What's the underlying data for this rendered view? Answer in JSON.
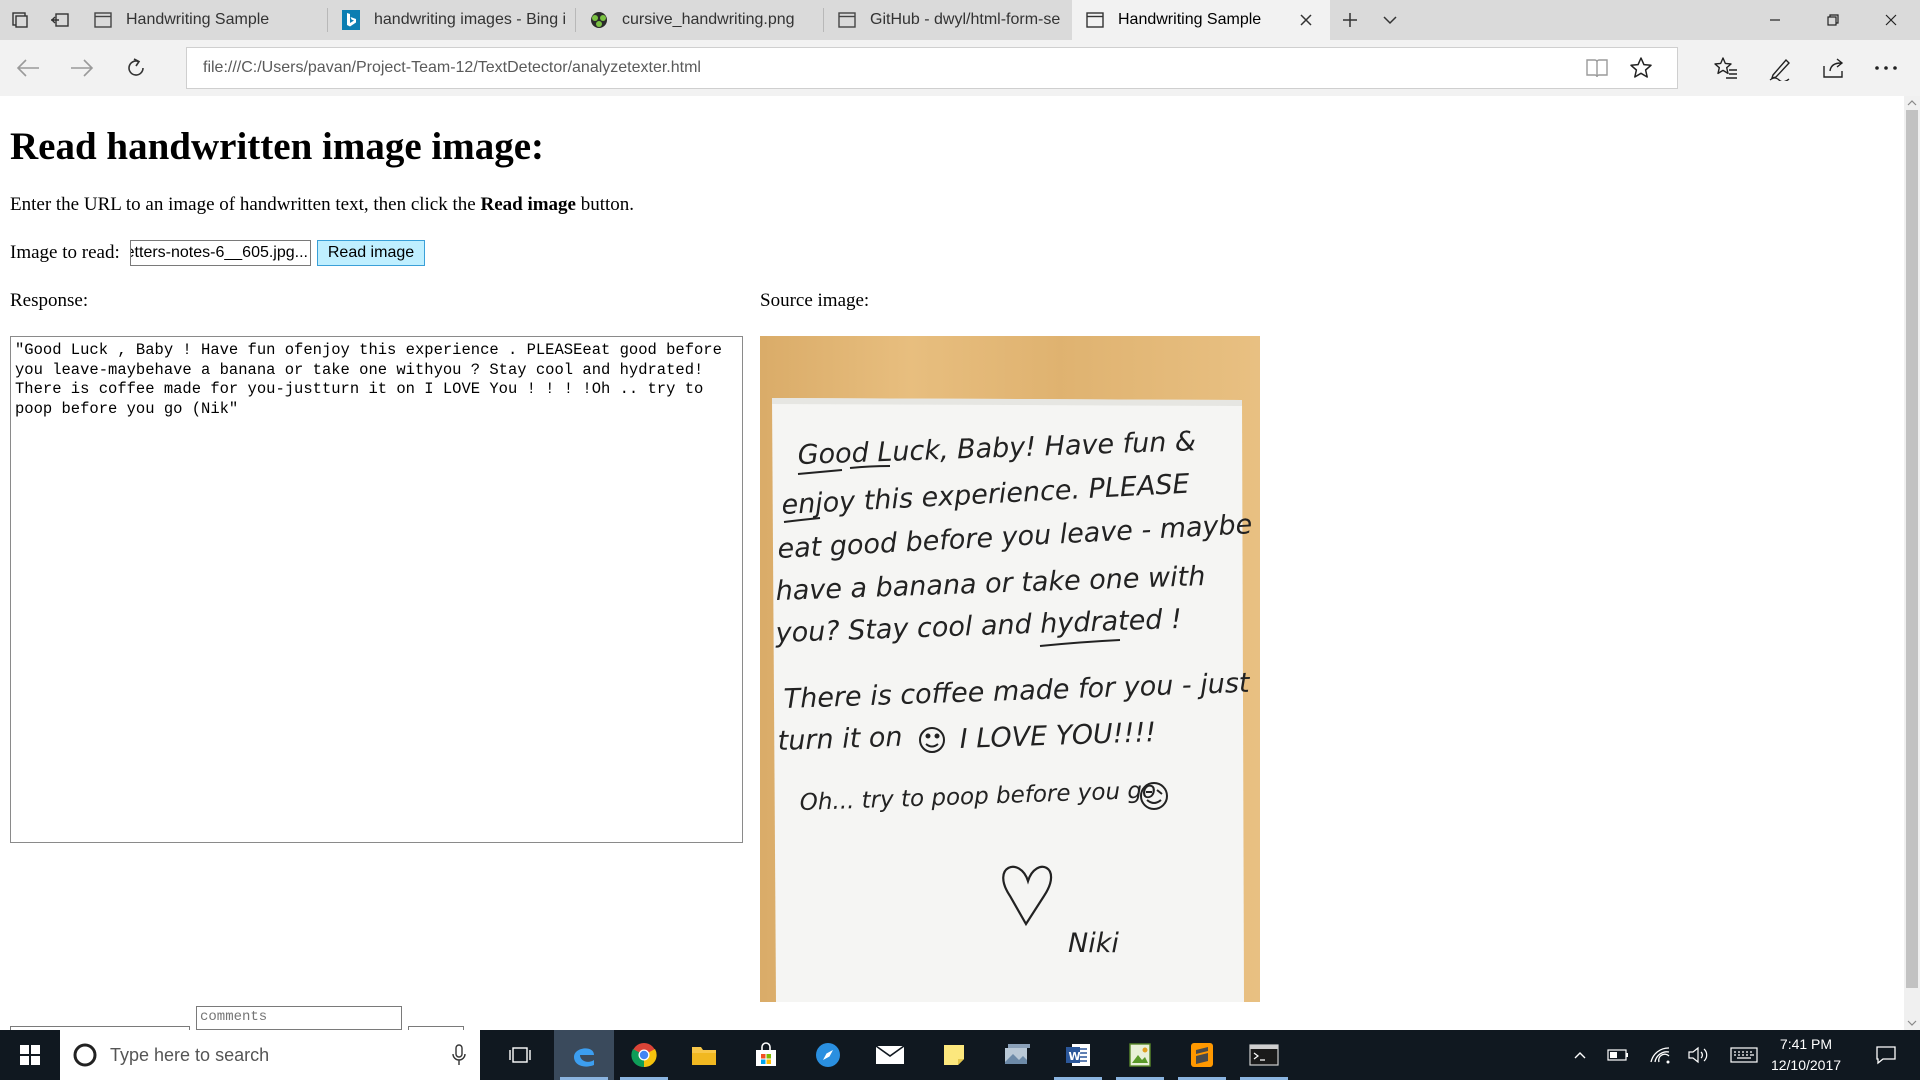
{
  "browser": {
    "tabs": [
      {
        "label": "Handwriting Sample",
        "icon": "page-icon",
        "active": false
      },
      {
        "label": "handwriting images - Bing i",
        "icon": "bing-icon",
        "active": false
      },
      {
        "label": "cursive_handwriting.png",
        "icon": "image-favicon",
        "active": false
      },
      {
        "label": "GitHub - dwyl/html-form-se",
        "icon": "page-icon",
        "active": false
      },
      {
        "label": "Handwriting Sample",
        "icon": "page-icon",
        "active": true
      }
    ],
    "address": "file:///C:/Users/pavan/Project-Team-12/TextDetector/analyzetexter.html"
  },
  "page": {
    "title": "Read handwritten image image:",
    "intro_before": "Enter the URL to an image of handwritten text, then click the ",
    "intro_bold": "Read image",
    "intro_after": " button.",
    "image_label": "Image to read:",
    "image_input_value": "...etters-notes-6__605.jpg",
    "read_button": "Read image",
    "response_label": "Response:",
    "source_label": "Source image:",
    "response_text": "\"Good Luck , Baby ! Have fun ofenjoy this experience . PLEASEeat good before you leave-maybehave a banana or take one withyou ? Stay cool and hydrated! There is coffee made for you-justturn it on I LOVE You ! ! ! !Oh .. try to poop before you go (Nik\"",
    "comments_placeholder": "comments",
    "note_lines": [
      "Good Luck, Baby! Have fun &",
      "enjoy this experience. PLEASE",
      "eat good before you leave - maybe",
      "have a banana or take one with",
      "you? Stay cool and hydrated !",
      "There is coffee made for you - just",
      "turn it on",
      "I LOVE YOU!!!!",
      "Oh... try to poop before you go",
      "Niki"
    ]
  },
  "taskbar": {
    "search_placeholder": "Type here to search",
    "time": "7:41 PM",
    "date": "12/10/2017"
  },
  "colors": {
    "accent": "#0078d7",
    "button_bg": "#bfefff",
    "taskbar": "#101820"
  }
}
